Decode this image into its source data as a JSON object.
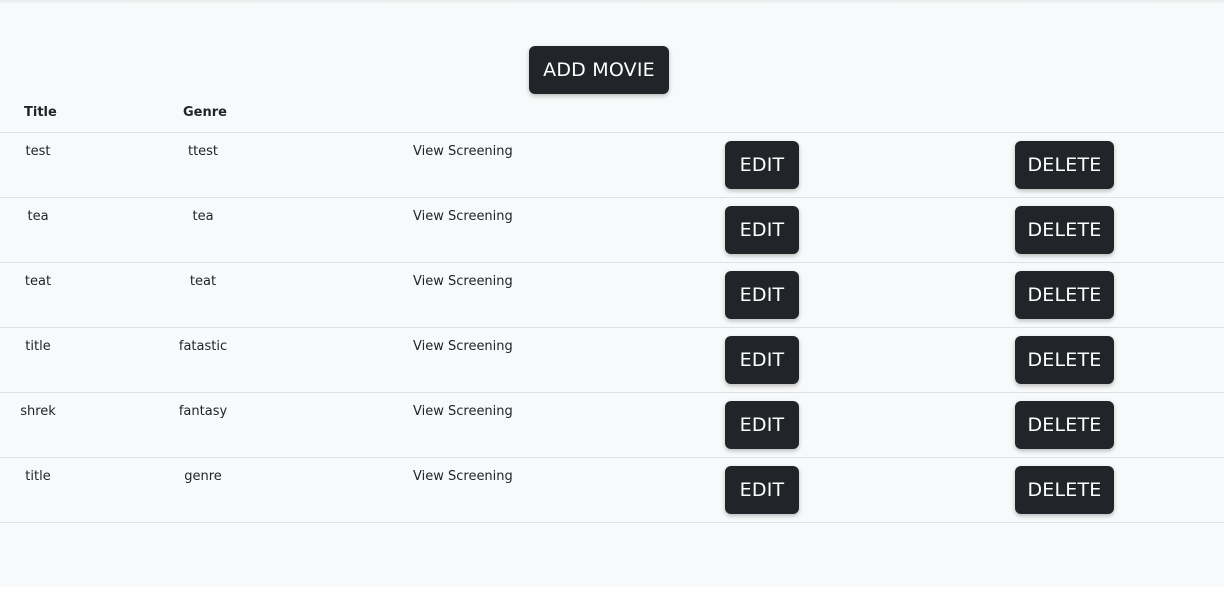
{
  "toolbar": {
    "add_label": "ADD MOVIE"
  },
  "table": {
    "headers": {
      "title": "Title",
      "genre": "Genre"
    },
    "rows": [
      {
        "title": "test",
        "genre": "ttest",
        "view": "View Screening",
        "edit": "EDIT",
        "delete": "DELETE"
      },
      {
        "title": "tea",
        "genre": "tea",
        "view": "View Screening",
        "edit": "EDIT",
        "delete": "DELETE"
      },
      {
        "title": "teat",
        "genre": "teat",
        "view": "View Screening",
        "edit": "EDIT",
        "delete": "DELETE"
      },
      {
        "title": "title",
        "genre": "fatastic",
        "view": "View Screening",
        "edit": "EDIT",
        "delete": "DELETE"
      },
      {
        "title": "shrek",
        "genre": "fantasy",
        "view": "View Screening",
        "edit": "EDIT",
        "delete": "DELETE"
      },
      {
        "title": "title",
        "genre": "genre",
        "view": "View Screening",
        "edit": "EDIT",
        "delete": "DELETE"
      }
    ]
  },
  "colors": {
    "button_bg": "#212529",
    "button_text": "#ffffff",
    "page_bg": "#f8f9fa",
    "row_border": "#dee2e6"
  }
}
